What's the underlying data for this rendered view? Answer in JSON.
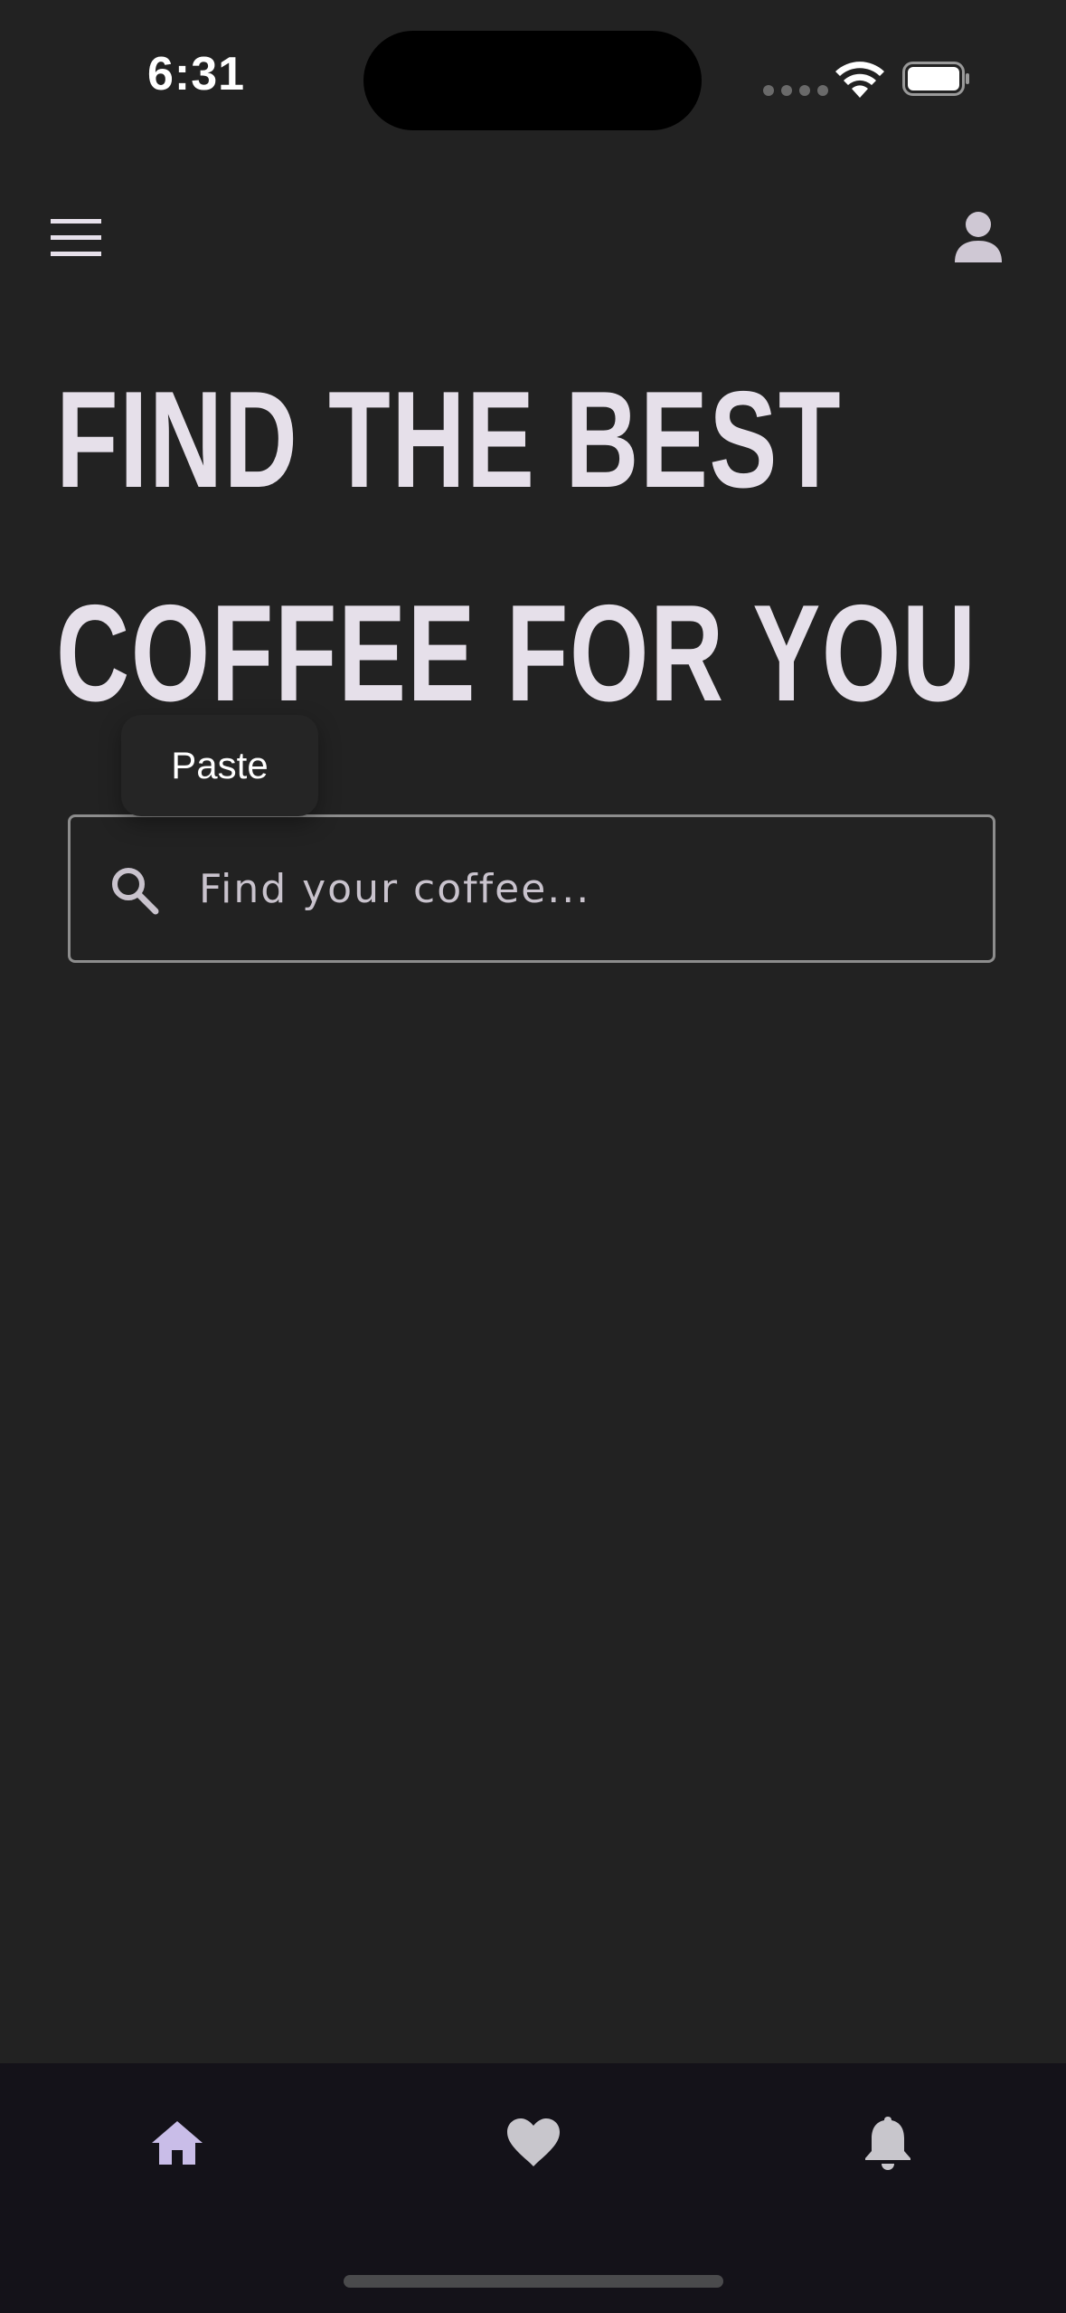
{
  "status_bar": {
    "time": "6:31"
  },
  "header": {
    "menu_icon": "hamburger-menu-icon",
    "profile_icon": "person-icon"
  },
  "hero": {
    "line1": "FIND THE BEST",
    "line2": "COFFEE FOR YOU"
  },
  "context_menu": {
    "paste_label": "Paste"
  },
  "search": {
    "placeholder": "Find your coffee...",
    "value": ""
  },
  "bottom_nav": {
    "items": [
      {
        "icon": "home-icon",
        "active": true
      },
      {
        "icon": "heart-icon",
        "active": false
      },
      {
        "icon": "bell-icon",
        "active": false
      }
    ]
  },
  "colors": {
    "background": "#222222",
    "nav_background": "#141219",
    "headline": "#e6e0ea",
    "active_nav": "#c9bde8",
    "inactive_nav": "#c8c6cc",
    "field_border": "#8d8d8d"
  }
}
